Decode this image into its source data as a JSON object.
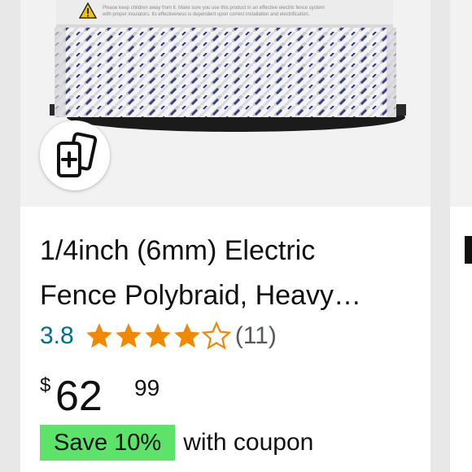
{
  "product": {
    "warning_line_1": "Please keep children away from it. Make sure you use this product in an effective electric fence system",
    "warning_line_2": "with proper insulators. Its effectiveness is dependent upon correct installation and electrification.",
    "title_line_1": "1/4inch (6mm) Electric",
    "title_line_2": "Fence Polybraid, Heavy…",
    "rating_value": "3.8",
    "rating_fraction": 0.76,
    "rating_count": "(11)",
    "price_symbol": "$",
    "price_whole": "62",
    "price_fraction": "99",
    "coupon_badge": "Save 10%",
    "coupon_text": "with coupon"
  },
  "icons": {
    "compare": "compare-cards-icon",
    "star_full": "star-full-icon",
    "star_empty": "star-empty-icon",
    "warning": "warning-triangle-icon"
  },
  "colors": {
    "rating_link": "#007185",
    "star": "#f08804",
    "coupon_badge": "#5ee36a",
    "rope_blue": "#3a3f86"
  }
}
